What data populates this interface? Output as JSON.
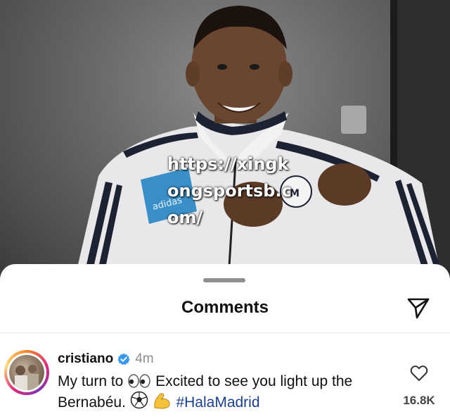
{
  "watermark": {
    "text": "https://xingkongsportsb.com/"
  },
  "photo": {
    "jacket_brand": "adidas"
  },
  "comments_sheet": {
    "title": "Comments",
    "send_icon": "send-icon"
  },
  "comment": {
    "username": "cristiano",
    "verified_icon": "verified-badge-icon",
    "time": "4m",
    "text_part1": "My turn to",
    "text_part2": "Excited to see you light up the Bernabéu.",
    "hashtag": "#HalaMadrid",
    "emojis": [
      "eyes-emoji",
      "soccer-ball-emoji",
      "flexed-biceps-emoji"
    ],
    "like_icon": "heart-icon",
    "likes": "16.8K"
  },
  "colors": {
    "accent_verified": "#3897f0",
    "hashtag": "#1a3f8f",
    "sheet_bg": "#ffffff"
  }
}
